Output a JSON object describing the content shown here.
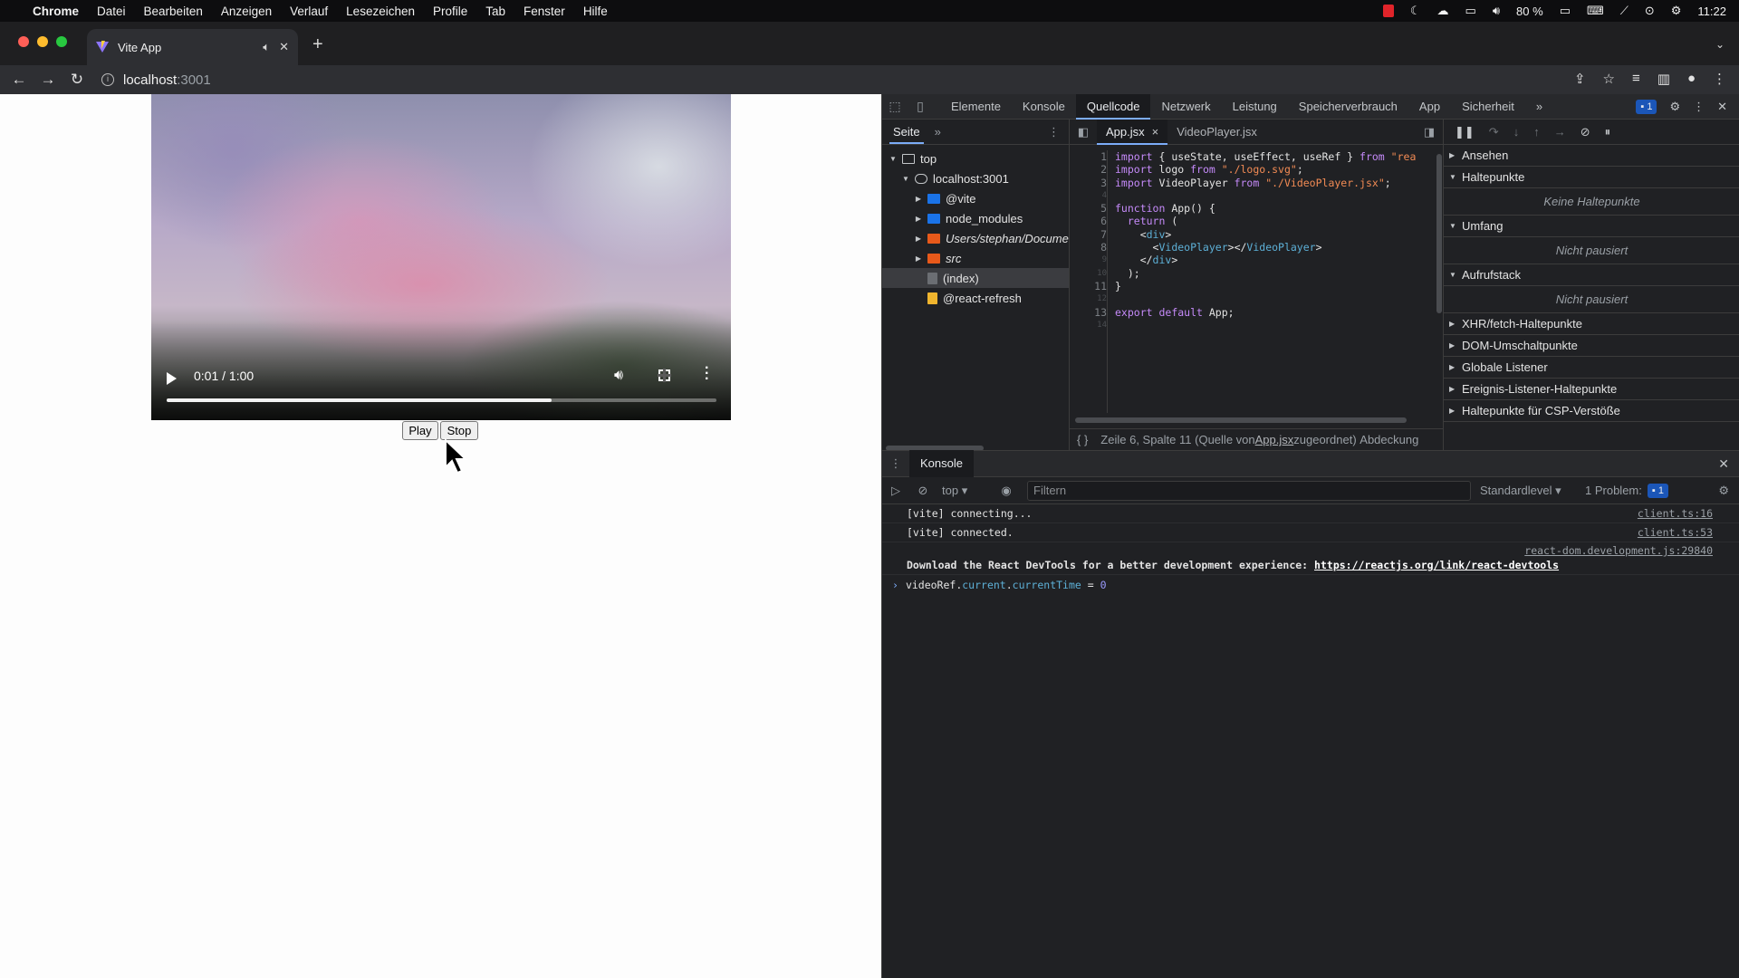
{
  "menubar": {
    "app": "Chrome",
    "items": [
      "Datei",
      "Bearbeiten",
      "Anzeigen",
      "Verlauf",
      "Lesezeichen",
      "Profile",
      "Tab",
      "Fenster",
      "Hilfe"
    ],
    "battery": "80 %",
    "clock": "11:22"
  },
  "browser": {
    "tab_title": "Vite App",
    "url_host": "localhost",
    "url_port": ":3001"
  },
  "page": {
    "video": {
      "time": "0:01 / 1:00",
      "progress_fraction": 0.7
    },
    "play_label": "Play",
    "stop_label": "Stop"
  },
  "devtools": {
    "panels": [
      "Elemente",
      "Konsole",
      "Quellcode",
      "Netzwerk",
      "Leistung",
      "Speicherverbrauch",
      "App",
      "Sicherheit"
    ],
    "active_panel": "Quellcode",
    "issues_badge": "1",
    "navigator": {
      "tab": "Seite",
      "tree": [
        {
          "label": "top",
          "level": 0,
          "type": "frame"
        },
        {
          "label": "localhost:3001",
          "level": 1,
          "type": "cloud"
        },
        {
          "label": "@vite",
          "level": 2,
          "type": "folder-blue"
        },
        {
          "label": "node_modules",
          "level": 2,
          "type": "folder-blue"
        },
        {
          "label": "Users/stephan/Docume",
          "level": 2,
          "type": "folder-orange"
        },
        {
          "label": "src",
          "level": 2,
          "type": "folder-orange"
        },
        {
          "label": "(index)",
          "level": 2,
          "type": "file-grey"
        },
        {
          "label": "@react-refresh",
          "level": 2,
          "type": "file-yellow"
        }
      ]
    },
    "editor": {
      "tabs": [
        "App.jsx",
        "VideoPlayer.jsx"
      ],
      "active_tab": "App.jsx",
      "status": "Zeile 6, Spalte 11",
      "status_source_prefix": "(Quelle von ",
      "status_source_file": "App.jsx",
      "status_source_suffix": " zugeordnet)",
      "status_coverage": "Abdeckung"
    },
    "debugger": {
      "sections": {
        "ansehen": "Ansehen",
        "haltepunkte": "Haltepunkte",
        "haltepunkte_empty": "Keine Haltepunkte",
        "umfang": "Umfang",
        "umfang_empty": "Nicht pausiert",
        "aufrufstack": "Aufrufstack",
        "aufrufstack_empty": "Nicht pausiert",
        "xhr": "XHR/fetch-Haltepunkte",
        "dom": "DOM-Umschaltpunkte",
        "global": "Globale Listener",
        "event": "Ereignis-Listener-Haltepunkte",
        "csp": "Haltepunkte für CSP-Verstöße"
      }
    },
    "console": {
      "drawer_tab": "Konsole",
      "context": "top",
      "filter_placeholder": "Filtern",
      "level": "Standardlevel",
      "problems_label": "1 Problem:",
      "problems_count": "1",
      "messages": [
        {
          "text": "[vite] connecting...",
          "source": "client.ts:16"
        },
        {
          "text": "[vite] connected.",
          "source": "client.ts:53"
        }
      ],
      "react_msg": {
        "text": "Download the React DevTools for a better development experience: ",
        "link": "https://reactjs.org/link/react-devtools",
        "source": "react-dom.development.js:29840"
      },
      "input": {
        "obj": "videoRef.",
        "prop1": "current",
        "dot": ".",
        "prop2": "currentTime",
        "op": " = ",
        "val": "0"
      }
    }
  },
  "colors": {
    "devtools_bg": "#202124",
    "accent": "#7cacf8",
    "keyword": "#c58af9",
    "string": "#f28b54",
    "tag": "#5db0d7"
  }
}
